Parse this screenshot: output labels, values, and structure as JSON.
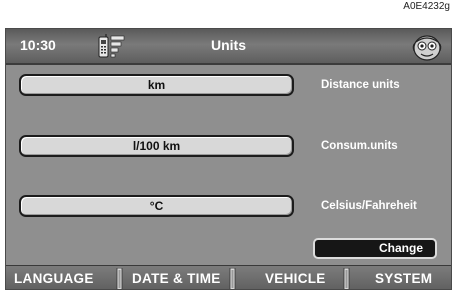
{
  "image_code": "A0E4232g",
  "header": {
    "time": "10:30",
    "title": "Units",
    "left_icon": "phone-icon",
    "right_icon": "mask-icon"
  },
  "rows": [
    {
      "value": "km",
      "label": "Distance units"
    },
    {
      "value": "l/100 km",
      "label": "Consum.units"
    },
    {
      "value": "°C",
      "label": "Celsius/Fahreheit"
    }
  ],
  "change_label": "Change",
  "tabs": [
    {
      "label": "LANGUAGE"
    },
    {
      "label": "DATE & TIME"
    },
    {
      "label": "VEHICLE"
    },
    {
      "label": "SYSTEM"
    }
  ],
  "colors": {
    "screen_bg": "#8f8f8f",
    "header_bg": "#6a6a6a",
    "field_bg": "#d8d8d8",
    "button_bg": "#161616"
  }
}
